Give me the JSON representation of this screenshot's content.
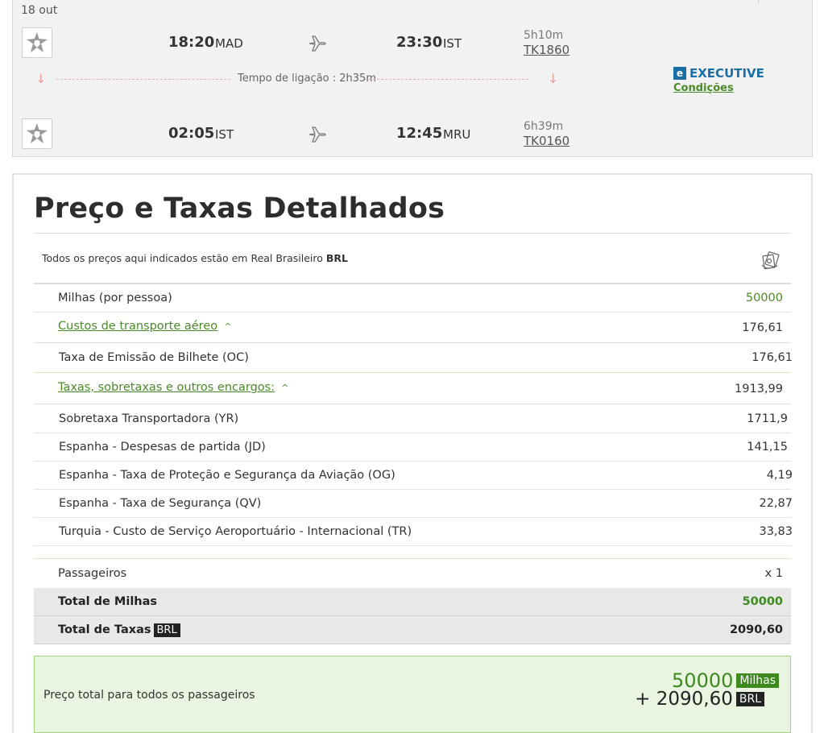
{
  "flight": {
    "date": "18 out",
    "segments": [
      {
        "dep_time": "18:20",
        "dep_code": "MAD",
        "arr_time": "23:30",
        "arr_code": "IST",
        "duration": "5h10m",
        "flight_no": "TK1860",
        "logo_icon": "star-alliance-icon"
      },
      {
        "dep_time": "02:05",
        "dep_code": "IST",
        "arr_time": "12:45",
        "arr_code": "MRU",
        "duration": "6h39m",
        "flight_no": "TK0160",
        "logo_icon": "star-alliance-icon"
      }
    ],
    "connection": "Tempo de ligação : 2h35m",
    "cabin": {
      "badge": "e",
      "name": "EXECUTIVE",
      "conditions": "Condições"
    }
  },
  "prices": {
    "title": "Preço e Taxas Detalhados",
    "currency_note_prefix": "Todos os preços aqui indicados estão em Real Brasileiro",
    "currency_code": "BRL",
    "miles_label": "Milhas (por pessoa)",
    "miles_value": "50000",
    "transport_label": "Custos de transporte aéreo",
    "transport_value": "176,61",
    "transport_items": [
      {
        "label": "Taxa de Emissão de Bilhete (OC)",
        "value": "176,61"
      }
    ],
    "taxes_label": "Taxas, sobretaxas e outros encargos:",
    "taxes_value": "1913,99",
    "tax_items": [
      {
        "label": "Sobretaxa Transportadora (YR)",
        "value": "1711,9"
      },
      {
        "label": "Espanha - Despesas de partida (JD)",
        "value": "141,15"
      },
      {
        "label": "Espanha - Taxa de Proteção e Segurança da Aviação (OG)",
        "value": "4,19"
      },
      {
        "label": "Espanha - Taxa de Segurança (QV)",
        "value": "22,87"
      },
      {
        "label": "Turquia - Custo de Serviço Aeroportuário - Internacional (TR)",
        "value": "33,83"
      }
    ],
    "passengers_label": "Passageiros",
    "passengers_value": "x 1",
    "total_miles_label": "Total de Milhas",
    "total_miles_value": "50000",
    "total_taxes_label": "Total de Taxas",
    "total_taxes_currency": "BRL",
    "total_taxes_value": "2090,60",
    "grand_total_label": "Preço total para todos os passageiros",
    "grand_total_miles": "50000",
    "grand_total_miles_unit": "Milhas",
    "grand_total_taxes": "+ 2090,60",
    "grand_total_taxes_unit": "BRL"
  },
  "colors": {
    "accent_green": "#4a8a28",
    "total_green": "#3d8a1f",
    "executive_blue": "#1a6fa8",
    "connection_arrow": "#e8a0a0"
  }
}
